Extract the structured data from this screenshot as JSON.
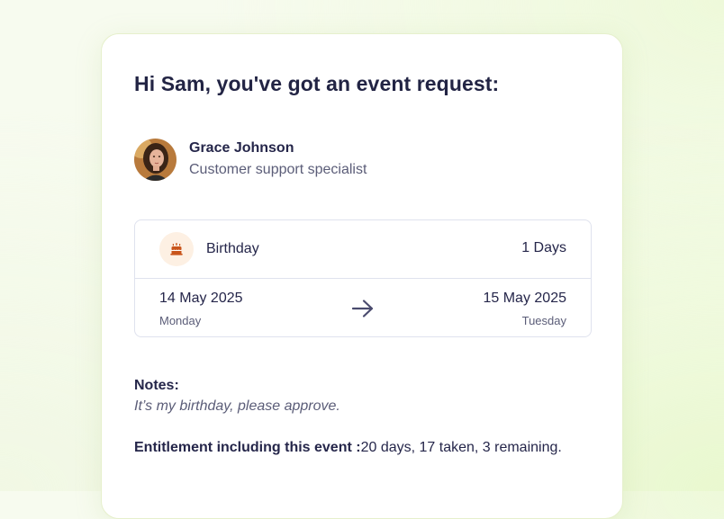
{
  "greeting": "Hi Sam, you've got an event request:",
  "requester": {
    "name": "Grace Johnson",
    "role": "Customer support specialist",
    "avatar_icon": "person-avatar"
  },
  "event": {
    "type": "Birthday",
    "icon": "birthday-cake-icon",
    "duration": "1 Days",
    "start_date": "14 May 2025",
    "start_day": "Monday",
    "end_date": "15 May 2025",
    "end_day": "Tuesday",
    "arrow_icon": "arrow-right-icon"
  },
  "notes": {
    "label": "Notes:",
    "text": "It’s my birthday, please approve."
  },
  "entitlement": {
    "label": "Entitlement including this event :",
    "value": "20 days, 17 taken, 3 remaining."
  },
  "colors": {
    "text_primary": "#25264a",
    "text_secondary": "#5b5d78",
    "border": "#dfe2ee",
    "icon_bg": "#fdf0e3",
    "icon_accent": "#c9541a"
  }
}
